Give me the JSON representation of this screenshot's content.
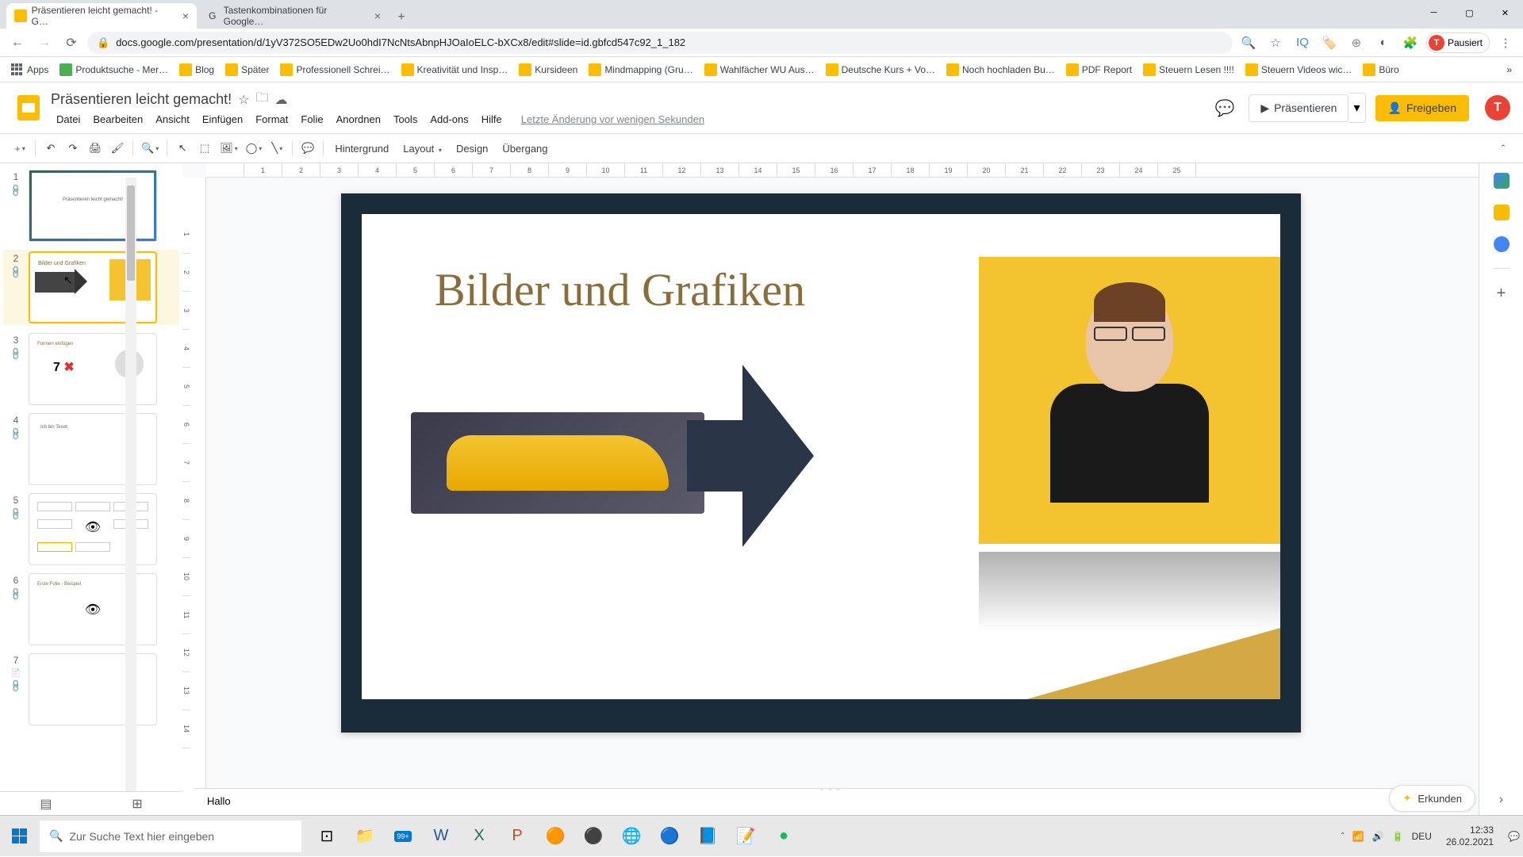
{
  "browser": {
    "tabs": [
      {
        "title": "Präsentieren leicht gemacht! - G…",
        "active": true
      },
      {
        "title": "Tastenkombinationen für Google…",
        "active": false
      }
    ],
    "url": "docs.google.com/presentation/d/1yV372SO5EDw2Uo0hdI7NcNtsAbnpHJOaIoELC-bXCx8/edit#slide=id.gbfcd547c92_1_182",
    "profile_label": "Pausiert",
    "profile_initial": "T"
  },
  "bookmarks": [
    "Apps",
    "Produktsuche - Mer…",
    "Blog",
    "Später",
    "Professionell Schrei…",
    "Kreativität und Insp…",
    "Kursideen",
    "Mindmapping (Gru…",
    "Wahlfächer WU Aus…",
    "Deutsche Kurs + Vo…",
    "Noch hochladen Bu…",
    "PDF Report",
    "Steuern Lesen !!!!",
    "Steuern Videos wic…",
    "Büro"
  ],
  "app": {
    "title": "Präsentieren leicht gemacht!",
    "menu": [
      "Datei",
      "Bearbeiten",
      "Ansicht",
      "Einfügen",
      "Format",
      "Folie",
      "Anordnen",
      "Tools",
      "Add-ons",
      "Hilfe"
    ],
    "status": "Letzte Änderung vor wenigen Sekunden",
    "present": "Präsentieren",
    "share": "Freigeben",
    "user_initial": "T"
  },
  "toolbar": {
    "background": "Hintergrund",
    "layout": "Layout",
    "design": "Design",
    "transition": "Übergang"
  },
  "ruler_h": [
    "",
    "1",
    "2",
    "3",
    "4",
    "5",
    "6",
    "7",
    "8",
    "9",
    "10",
    "11",
    "12",
    "13",
    "14",
    "15",
    "16",
    "17",
    "18",
    "19",
    "20",
    "21",
    "22",
    "23",
    "24",
    "25"
  ],
  "ruler_v": [
    "",
    "1",
    "2",
    "3",
    "4",
    "5",
    "6",
    "7",
    "8",
    "9",
    "10",
    "11",
    "12",
    "13",
    "14"
  ],
  "slides": [
    {
      "num": "1",
      "title": "Präsentieren leicht gemacht!"
    },
    {
      "num": "2",
      "title": "Bilder und Grafiken"
    },
    {
      "num": "3",
      "title": "Formen einfügen",
      "extra": "7 ✖"
    },
    {
      "num": "4",
      "title": "Ich bin Texet."
    },
    {
      "num": "5",
      "title": ""
    },
    {
      "num": "6",
      "title": "Erste Folie - Beispiel"
    },
    {
      "num": "7",
      "title": ""
    }
  ],
  "current_slide": {
    "title": "Bilder und Grafiken"
  },
  "notes": "Hallo",
  "explore": "Erkunden",
  "taskbar": {
    "search_placeholder": "Zur Suche Text hier eingeben",
    "lang": "DEU",
    "time": "12:33",
    "date": "26.02.2021",
    "notify": "99+"
  }
}
